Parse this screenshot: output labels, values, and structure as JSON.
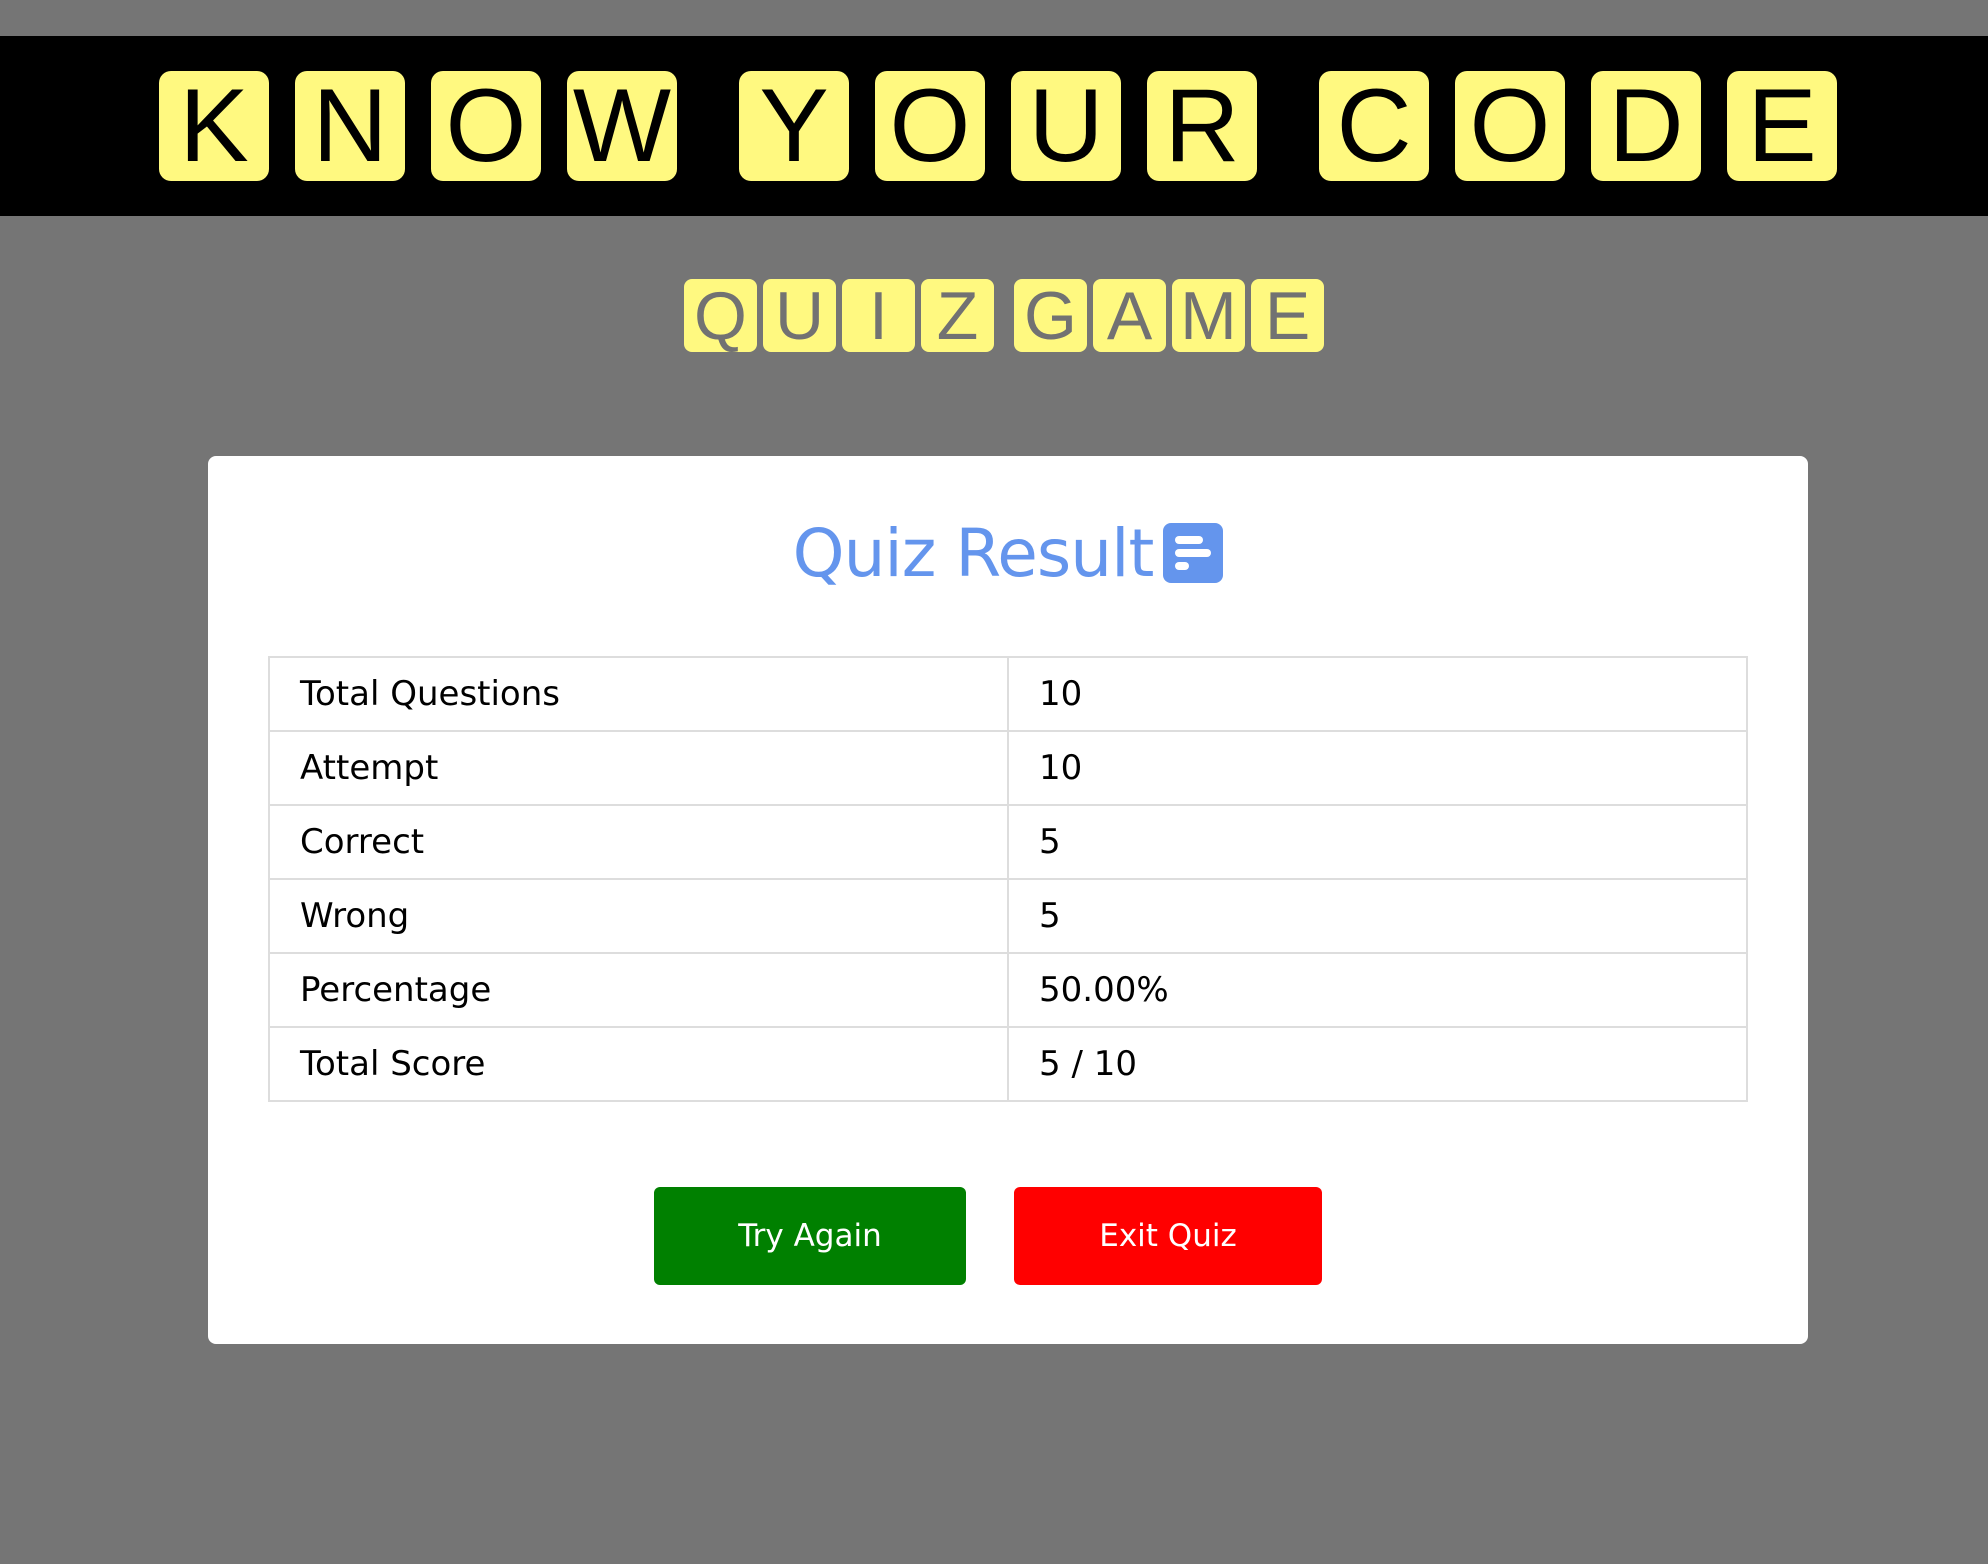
{
  "header": {
    "title_letters": [
      "K",
      "N",
      "O",
      "W",
      "Y",
      "O",
      "U",
      "R",
      "C",
      "O",
      "D",
      "E"
    ],
    "subtitle_letters": [
      "Q",
      "U",
      "I",
      "Z",
      "G",
      "A",
      "M",
      "E"
    ]
  },
  "result": {
    "title": "Quiz Result",
    "icon": "chart-bars-icon",
    "rows": [
      {
        "label": "Total Questions",
        "value": "10"
      },
      {
        "label": "Attempt",
        "value": "10"
      },
      {
        "label": "Correct",
        "value": "5"
      },
      {
        "label": "Wrong",
        "value": "5"
      },
      {
        "label": "Percentage",
        "value": "50.00%"
      },
      {
        "label": "Total Score",
        "value": "5 / 10"
      }
    ],
    "try_again_label": "Try Again",
    "exit_label": "Exit Quiz"
  },
  "colors": {
    "page_background": "#757575",
    "title_bar": "#000000",
    "tile": "#fff980",
    "accent": "#6495ed",
    "try_again": "#008000",
    "exit": "#ff0000"
  }
}
